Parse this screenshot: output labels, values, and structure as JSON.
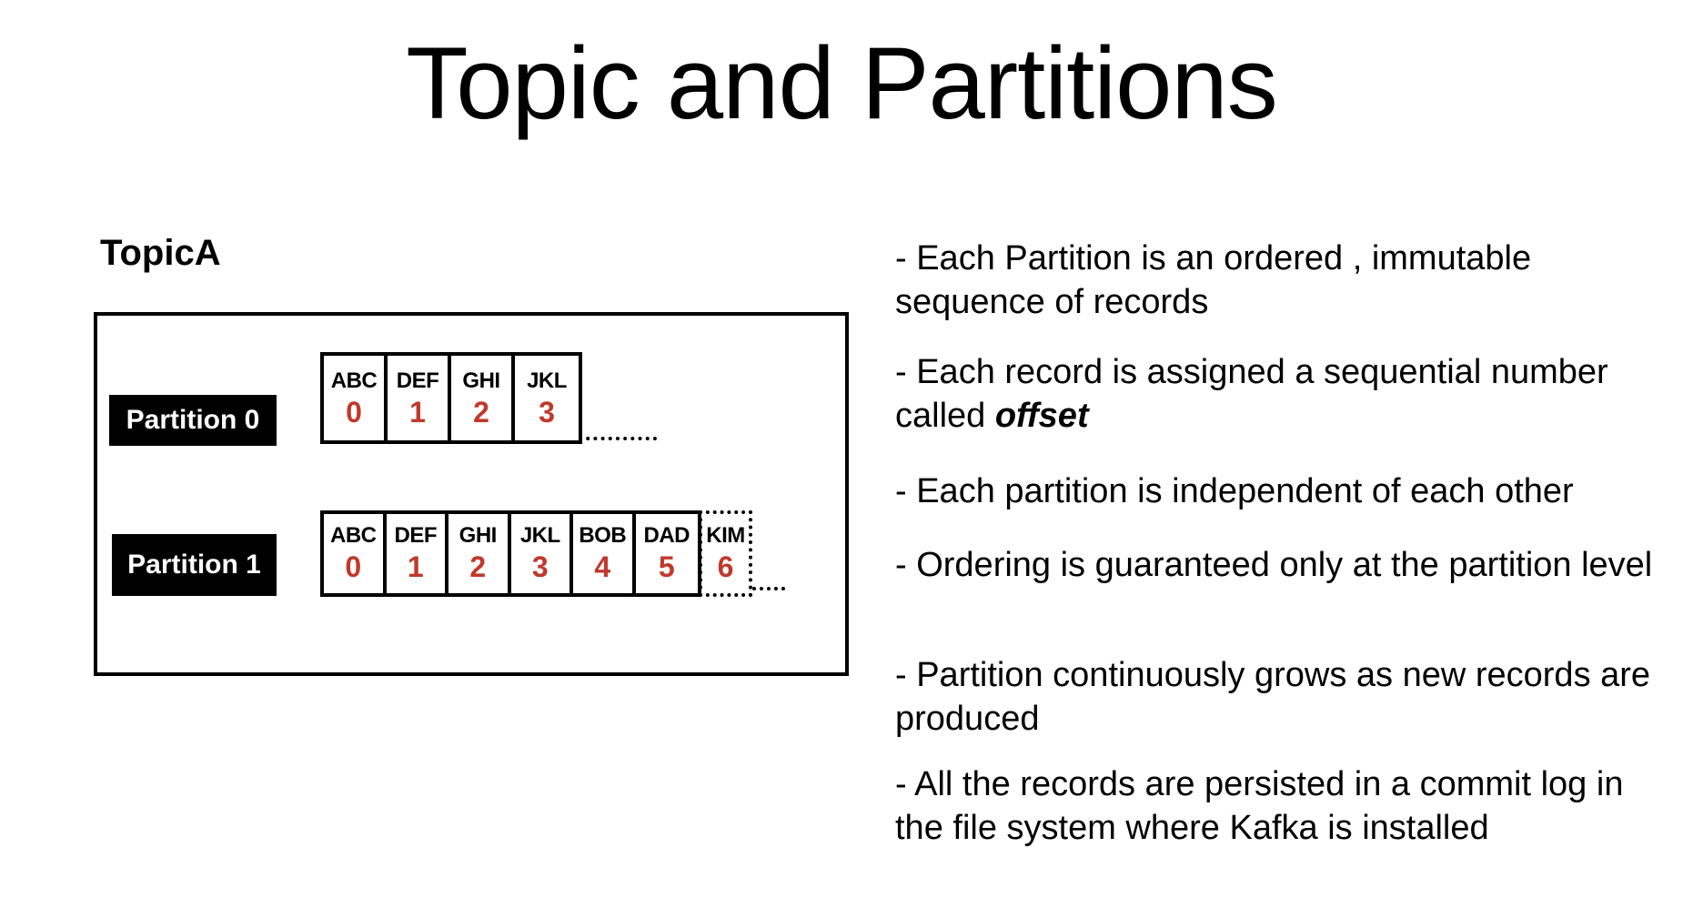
{
  "title": "Topic and Partitions",
  "topic": {
    "name": "TopicA",
    "partitions": [
      {
        "label": "Partition 0",
        "records": [
          {
            "name": "ABC",
            "offset": "0"
          },
          {
            "name": "DEF",
            "offset": "1"
          },
          {
            "name": "GHI",
            "offset": "2"
          },
          {
            "name": "JKL",
            "offset": "3"
          }
        ]
      },
      {
        "label": "Partition 1",
        "records": [
          {
            "name": "ABC",
            "offset": "0"
          },
          {
            "name": "DEF",
            "offset": "1"
          },
          {
            "name": "GHI",
            "offset": "2"
          },
          {
            "name": "JKL",
            "offset": "3"
          },
          {
            "name": "BOB",
            "offset": "4"
          },
          {
            "name": "DAD",
            "offset": "5"
          }
        ],
        "pending_record": {
          "name": "KIM",
          "offset": "6"
        }
      }
    ]
  },
  "bullets": [
    {
      "text": "- Each Partition is an ordered , immutable sequence of records"
    },
    {
      "text": "- Each record is assigned a sequential number called ",
      "emphasis": "offset"
    },
    {
      "text": "- Each partition is independent of each other"
    },
    {
      "text": "- Ordering is guaranteed only at the partition level"
    },
    {
      "text": "- Partition continuously grows as new records are produced"
    },
    {
      "text": "- All the records are persisted in a commit log in the file system where Kafka is installed"
    }
  ],
  "colors": {
    "offset": "#c0392b",
    "label_bg": "#000000",
    "label_text": "#ffffff"
  }
}
